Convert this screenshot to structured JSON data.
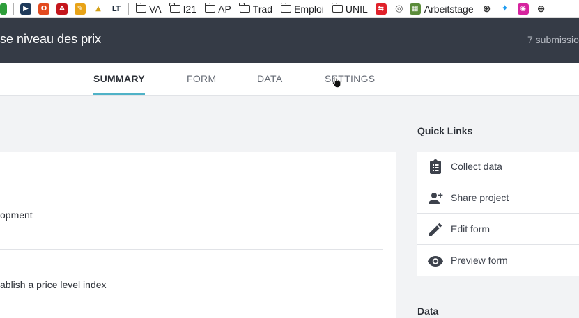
{
  "bookmarks": {
    "folders": [
      "VA",
      "I21",
      "AP",
      "Trad",
      "Emploi",
      "UNIL"
    ],
    "link_label": "Arbeitstage"
  },
  "header": {
    "title": "se niveau des prix",
    "submissions": "7 submissio"
  },
  "tabs": [
    "SUMMARY",
    "FORM",
    "DATA",
    "SETTINGS"
  ],
  "card": {
    "row1_text": "opment",
    "row2_text": "ablish a price level index"
  },
  "quick_links": {
    "title": "Quick Links",
    "items": [
      "Collect data",
      "Share project",
      "Edit form",
      "Preview form"
    ]
  },
  "data_section": {
    "title": "Data"
  },
  "colors": {
    "header_bg": "#353b46",
    "accent": "#4fb2c7",
    "icon": "#3d424c"
  }
}
